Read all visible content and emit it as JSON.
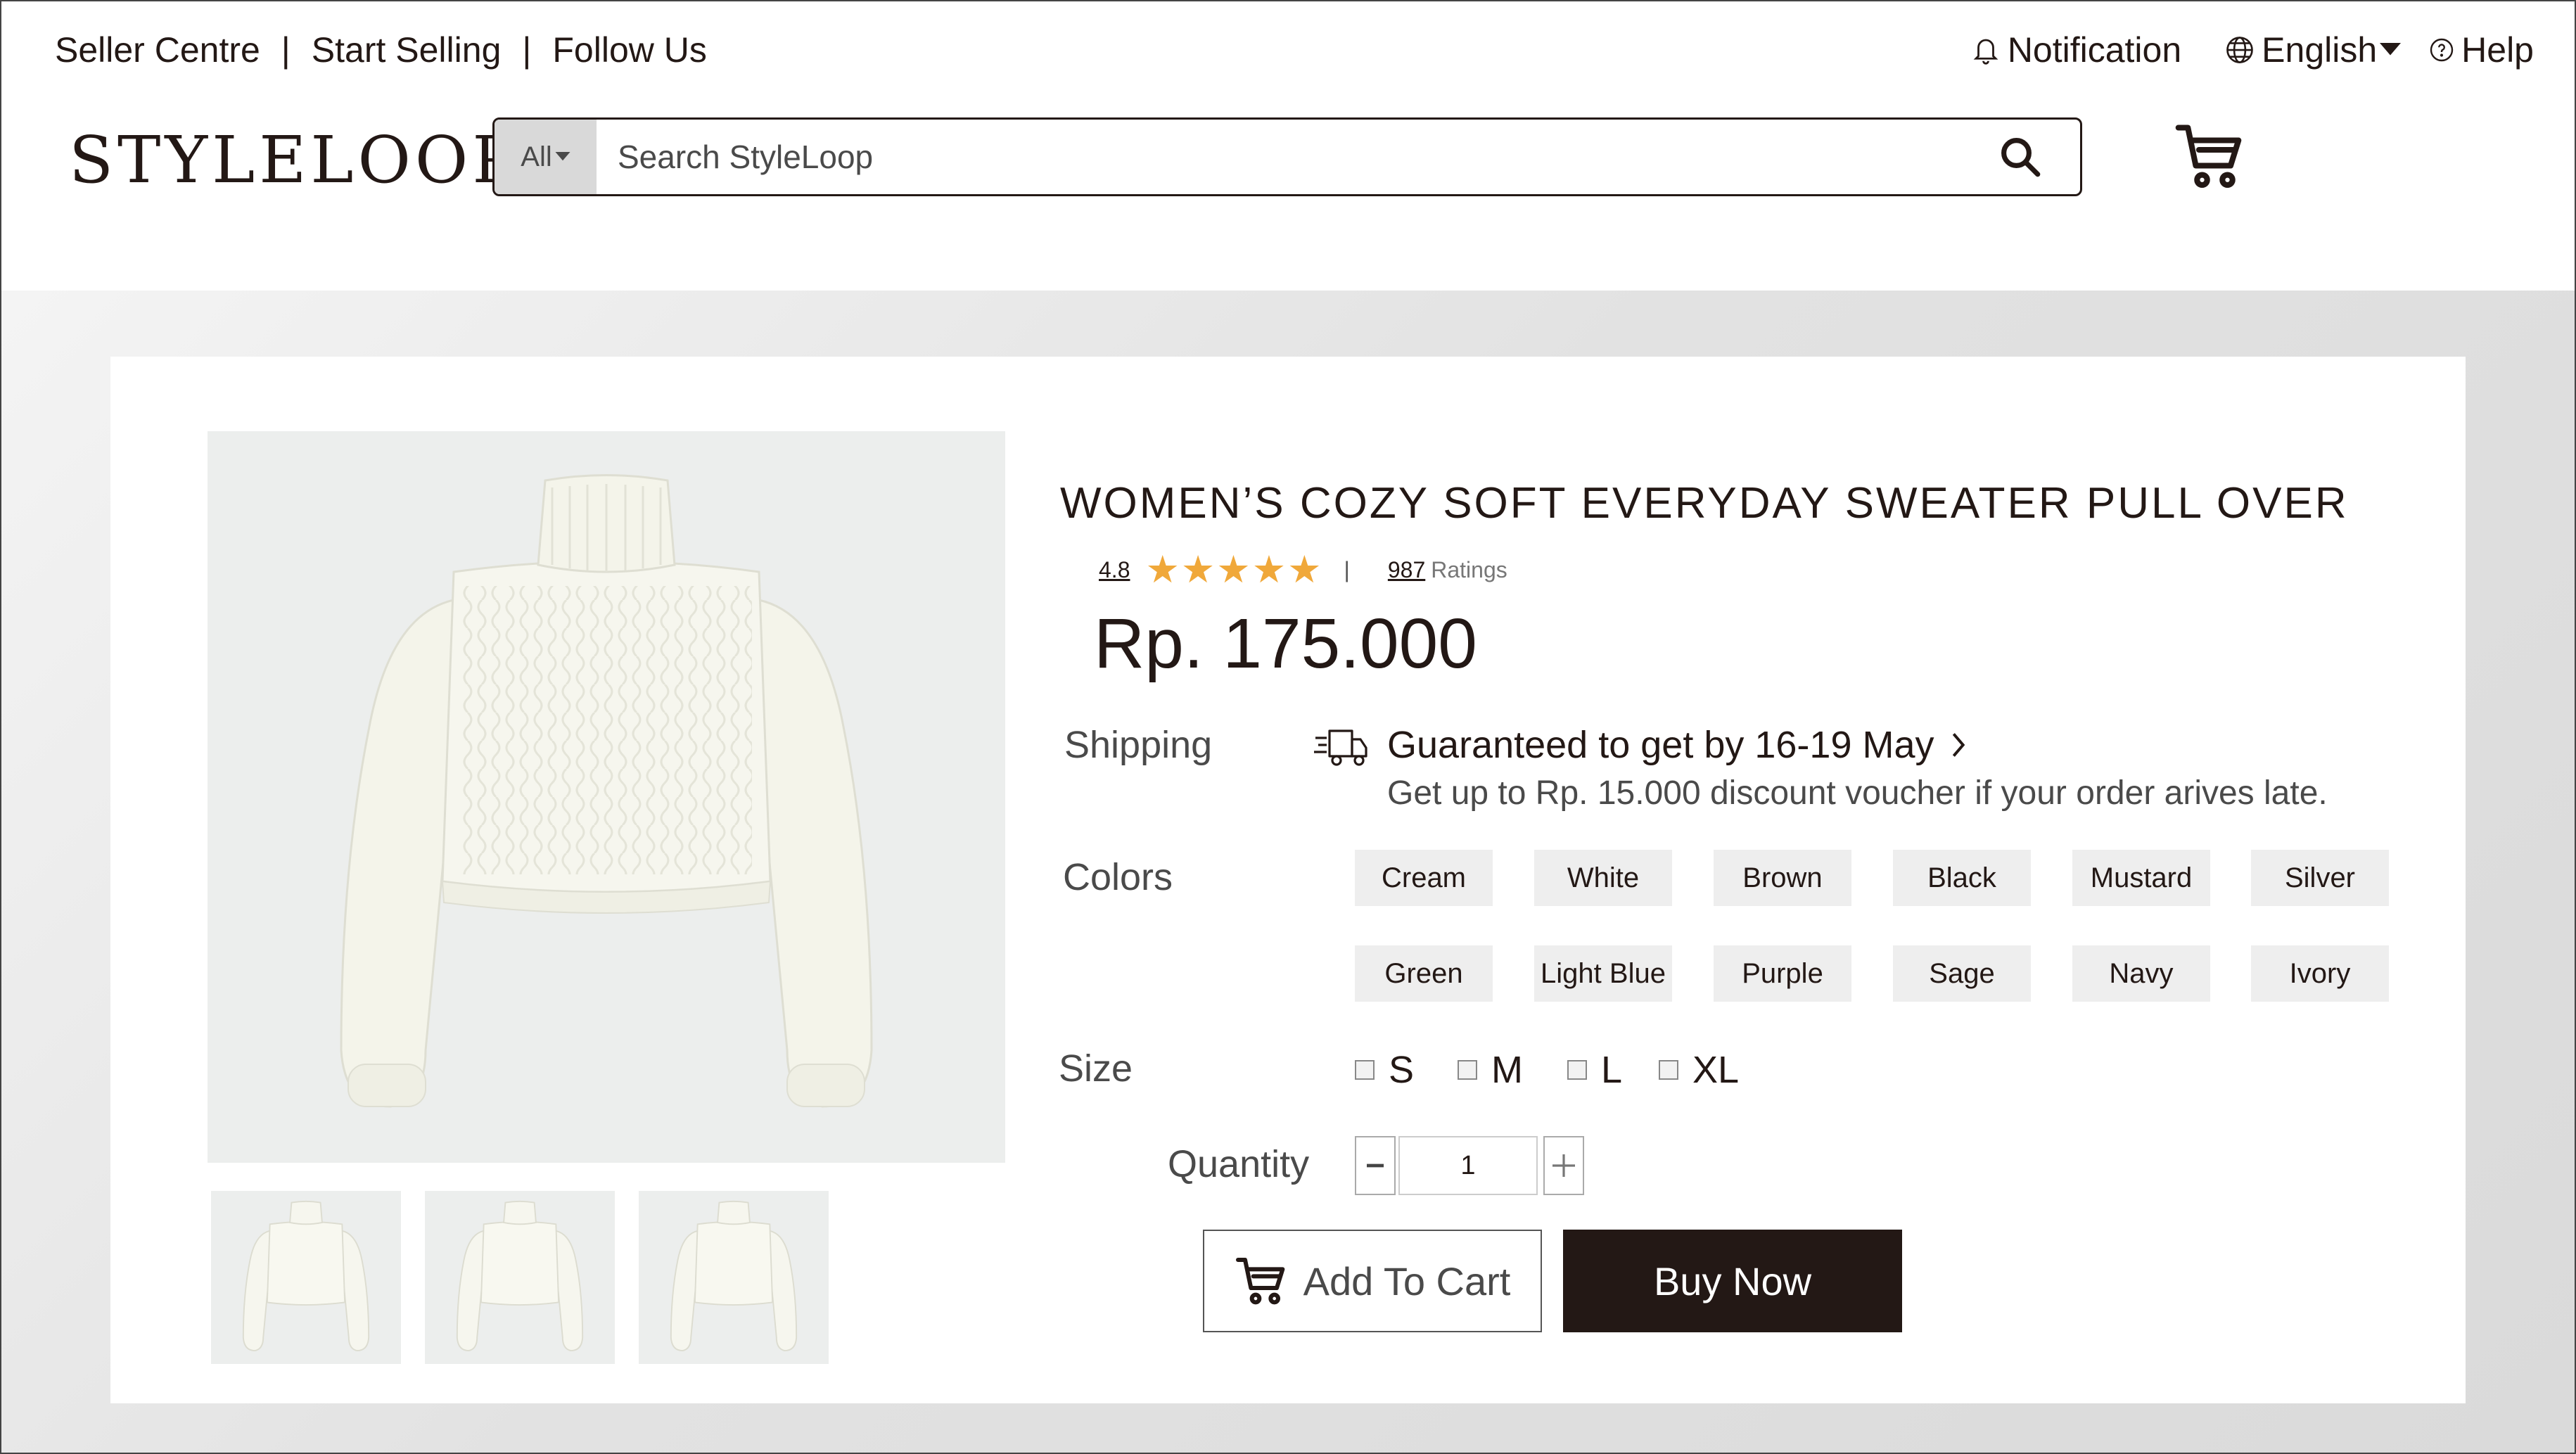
{
  "topbar": {
    "links": [
      "Seller Centre",
      "Start Selling",
      "Follow Us"
    ],
    "separator": "|",
    "notification": "Notification",
    "language": "English",
    "help": "Help"
  },
  "header": {
    "logo": "STYLELOOP",
    "search_category": "All",
    "search_placeholder": "Search StyleLoop"
  },
  "product": {
    "title": "WOMEN’S COZY SOFT EVERYDAY SWEATER PULL OVER",
    "rating_value": "4.8",
    "stars": 5,
    "ratings_count": "987",
    "ratings_label": "Ratings",
    "rating_separator": "|",
    "price": "Rp. 175.000",
    "shipping_label": "Shipping",
    "shipping_guarantee": "Guaranteed to get by 16-19 May",
    "shipping_voucher": "Get up to Rp. 15.000 discount voucher if your order arives late.",
    "colors_label": "Colors",
    "colors": [
      "Cream",
      "White",
      "Brown",
      "Black",
      "Mustard",
      "Silver",
      "Green",
      "Light Blue",
      "Purple",
      "Sage",
      "Navy",
      "Ivory"
    ],
    "size_label": "Size",
    "sizes": [
      "S",
      "M",
      "L",
      "XL"
    ],
    "quantity_label": "Quantity",
    "quantity": "1",
    "add_to_cart": "Add To Cart",
    "buy_now": "Buy Now"
  },
  "theme": {
    "dark": "#231815",
    "star": "#f0a83a",
    "image_bg": "#eceeed"
  }
}
